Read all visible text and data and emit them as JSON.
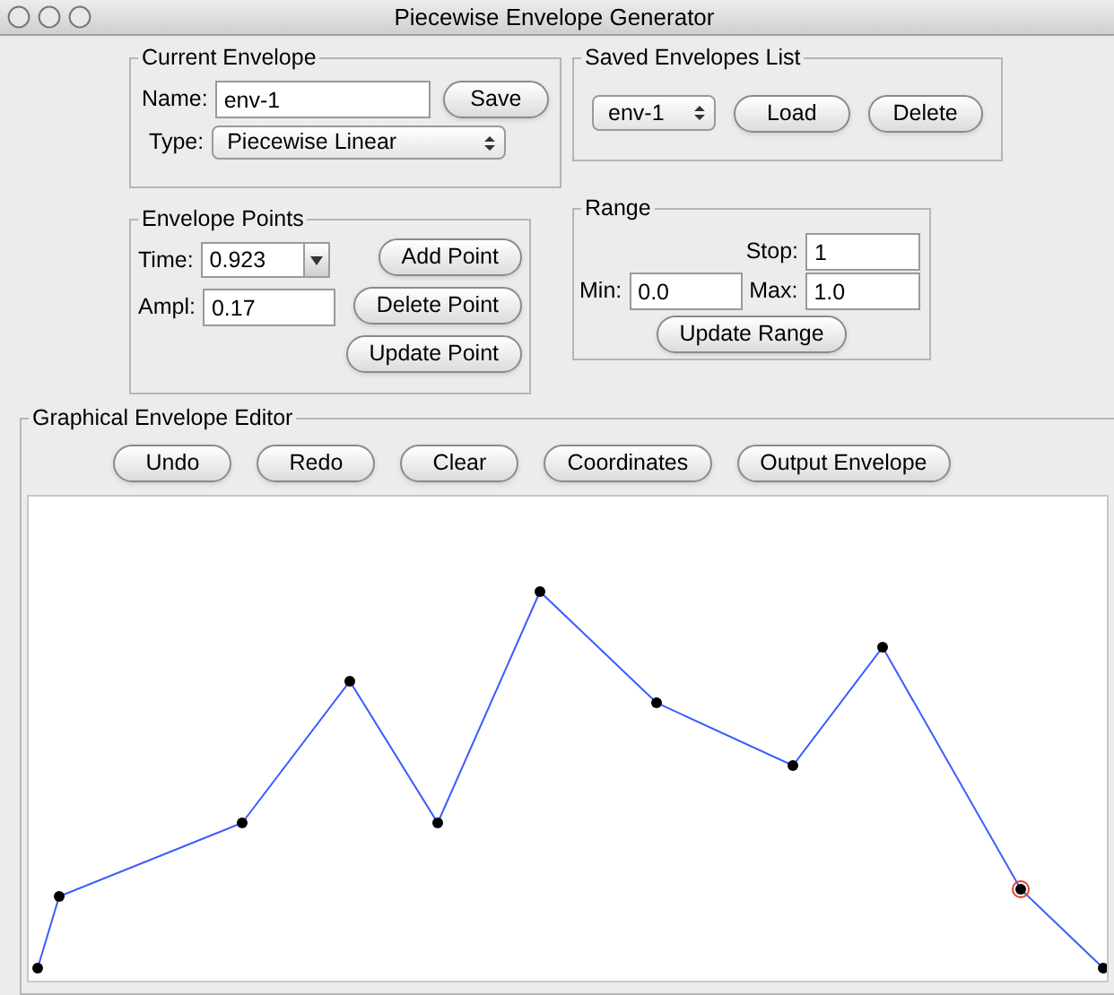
{
  "window": {
    "title": "Piecewise Envelope Generator"
  },
  "current_envelope": {
    "title": "Current Envelope",
    "name_label": "Name:",
    "name_value": "env-1",
    "save_button": "Save",
    "type_label": "Type:",
    "type_value": "Piecewise Linear"
  },
  "saved_envelopes": {
    "title": "Saved Envelopes List",
    "selected_value": "env-1",
    "load_button": "Load",
    "delete_button": "Delete"
  },
  "envelope_points": {
    "title": "Envelope Points",
    "time_label": "Time:",
    "time_value": "0.923",
    "ampl_label": "Ampl:",
    "ampl_value": "0.17",
    "buttons": [
      "Add Point",
      "Delete Point",
      "Update Point"
    ]
  },
  "range": {
    "title": "Range",
    "stop_label": "Stop:",
    "stop_value": "1",
    "min_label": "Min:",
    "min_value": "0.0",
    "max_label": "Max:",
    "max_value": "1.0",
    "update_button": "Update Range"
  },
  "editor": {
    "title": "Graphical Envelope Editor",
    "buttons": [
      "Undo",
      "Redo",
      "Clear",
      "Coordinates",
      "Output Envelope"
    ]
  }
}
